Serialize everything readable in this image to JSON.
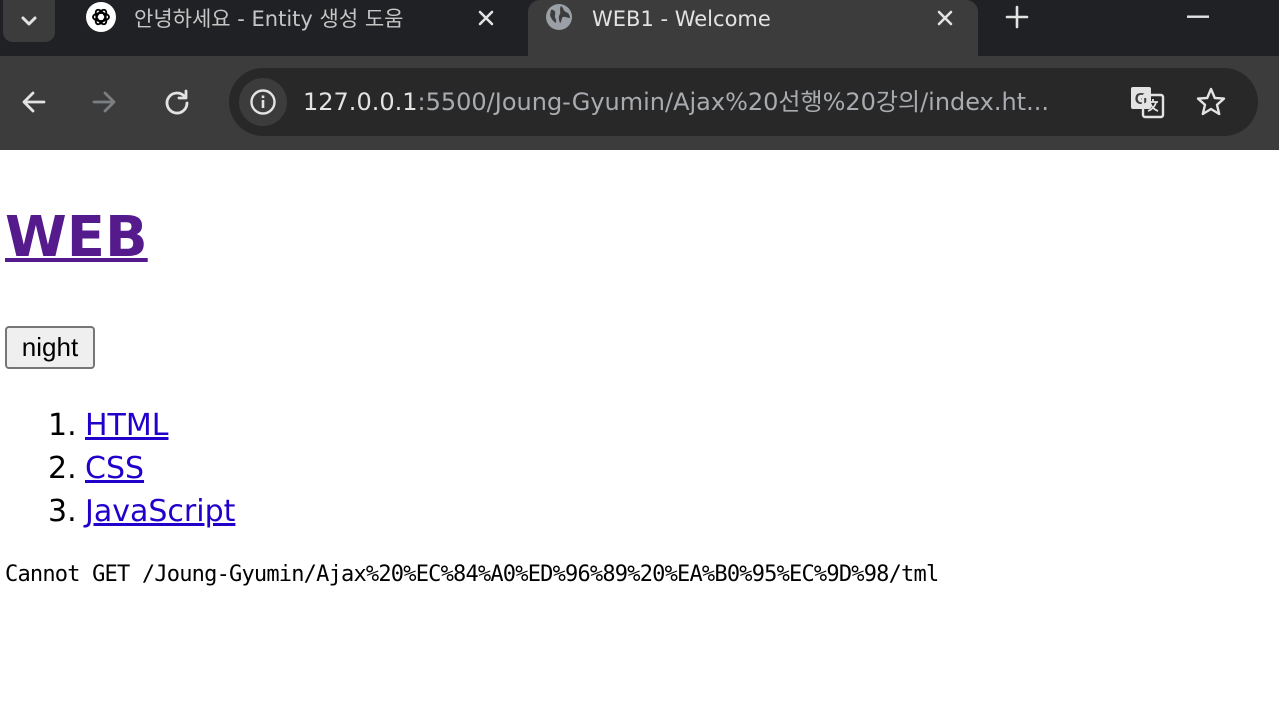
{
  "browser": {
    "tabs": [
      {
        "title": "안녕하세요 - Entity 생성 도움",
        "favicon": "chatgpt-logo-icon",
        "active": false
      },
      {
        "title": "WEB1 - Welcome",
        "favicon": "globe-icon",
        "active": true
      }
    ],
    "address_bar": {
      "url_host": "127.0.0.1",
      "url_rest": ":5500/Joung-Gyumin/Ajax%20선행%20강의/index.ht..."
    },
    "icons": {
      "tab_search": "chevron-down-icon",
      "close": "close-icon",
      "new_tab": "plus-icon",
      "minimize": "minimize-icon",
      "back": "back-arrow-icon",
      "forward": "forward-arrow-icon",
      "reload": "reload-icon",
      "site_info": "info-icon",
      "translate": "translate-icon",
      "bookmark": "star-icon"
    },
    "colors": {
      "tabstrip_bg": "#202124",
      "toolbar_bg": "#3c3c3c",
      "omnibox_bg": "#282828"
    }
  },
  "page": {
    "heading": "WEB",
    "night_button": "night",
    "nav": [
      {
        "number": "1.",
        "label": "HTML"
      },
      {
        "number": "2.",
        "label": "CSS"
      },
      {
        "number": "3.",
        "label": "JavaScript"
      }
    ],
    "error_message": "Cannot GET /Joung-Gyumin/Ajax%20%EC%84%A0%ED%96%89%20%EA%B0%95%EC%9D%98/tml",
    "colors": {
      "visited_link": "#551a8b",
      "link": "#2200cc"
    }
  }
}
